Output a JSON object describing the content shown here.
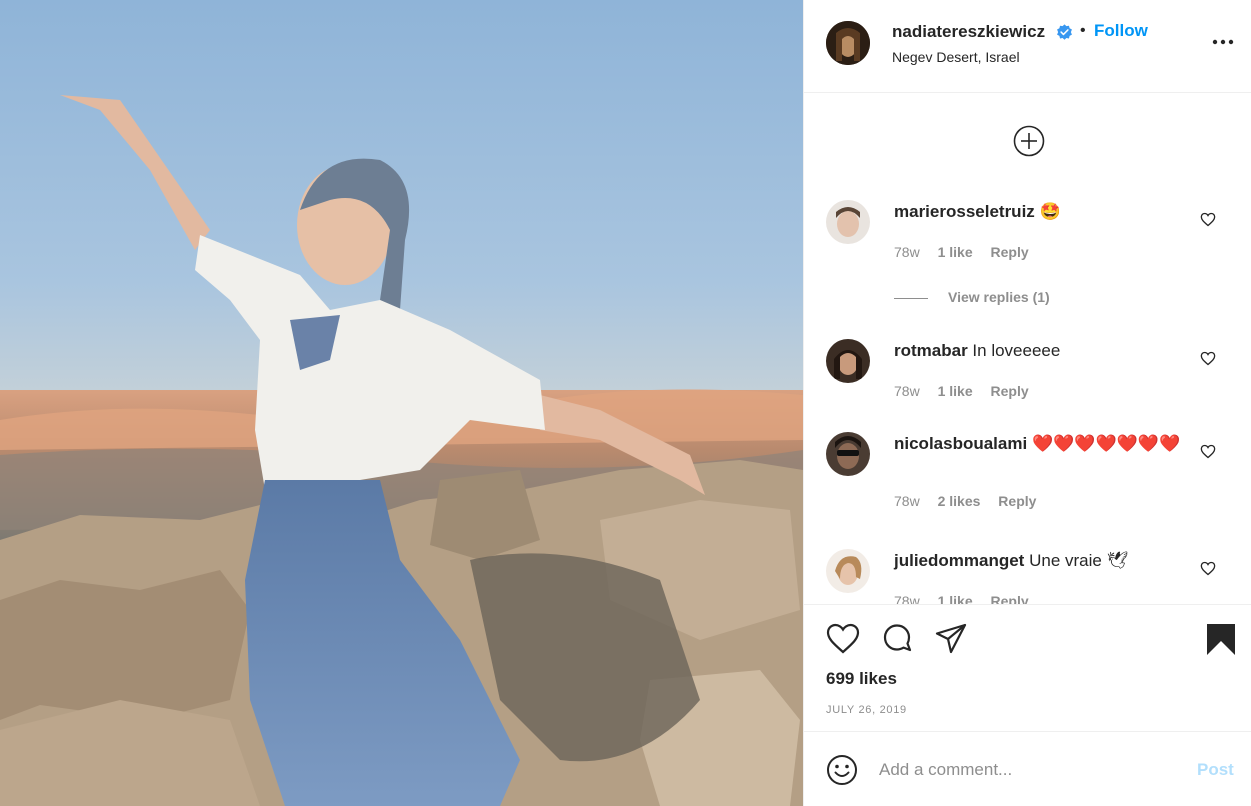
{
  "post": {
    "username": "nadiatereszkiewicz",
    "verified": true,
    "follow_label": "Follow",
    "separator": "•",
    "location": "Negev Desert, Israel",
    "likes": "699 likes",
    "date": "JULY 26, 2019"
  },
  "comments": [
    {
      "username": "marierosseletruiz",
      "text": "🤩",
      "age": "78w",
      "likes": "1 like",
      "reply_label": "Reply",
      "view_replies": "View replies (1)"
    },
    {
      "username": "rotmabar",
      "text": "In loveeeee",
      "age": "78w",
      "likes": "1 like",
      "reply_label": "Reply"
    },
    {
      "username": "nicolasboualami",
      "text": "❤️❤️❤️❤️❤️❤️❤️",
      "age": "78w",
      "likes": "2 likes",
      "reply_label": "Reply"
    },
    {
      "username": "juliedommanget",
      "text": "Une vraie 🕊",
      "age": "78w",
      "likes": "1 like",
      "reply_label": "Reply"
    }
  ],
  "add_comment": {
    "placeholder": "Add a comment...",
    "post_label": "Post"
  },
  "icons": {
    "more": "more-options-icon",
    "load_more": "load-more-comments-icon",
    "like": "heart-icon",
    "comment": "comment-icon",
    "share": "share-icon",
    "save": "bookmark-icon",
    "emoji": "emoji-icon"
  },
  "colors": {
    "accent": "#0095f6",
    "verified": "#3897f0",
    "post_disabled": "#b2dffc",
    "meta_text": "#8e8e8e"
  }
}
